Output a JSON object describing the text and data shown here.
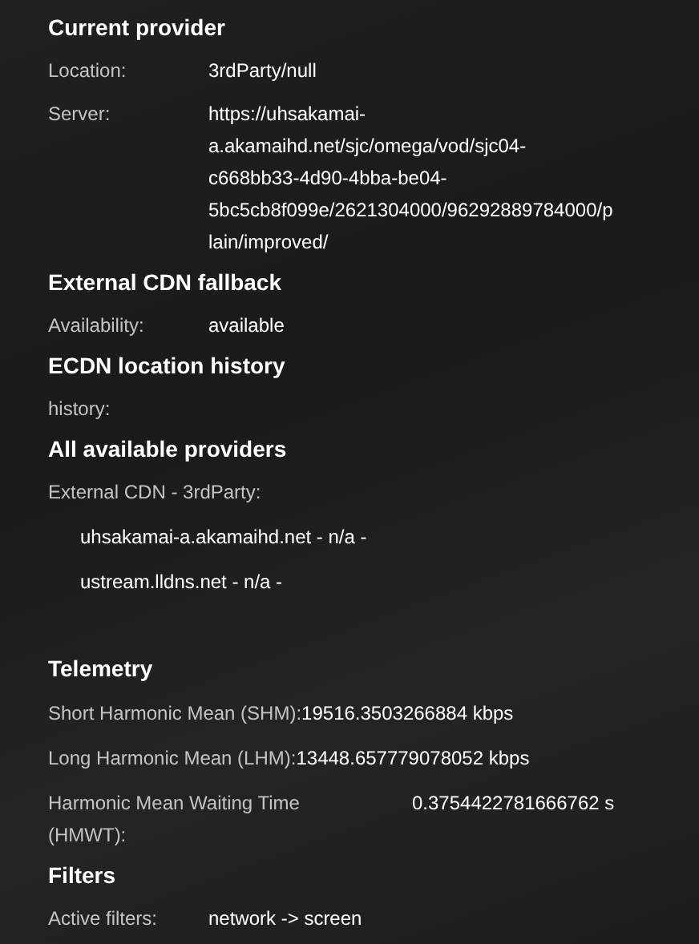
{
  "sections": [
    {
      "title": "Current provider",
      "rows": [
        {
          "kind": "pair",
          "label": "Location:",
          "value": "3rdParty/null"
        },
        {
          "kind": "pair",
          "label": "Server:",
          "value": "https://uhsakamai-a.akamaihd.net/sjc/omega/vod/sjc04-c668bb33-4d90-4bba-be04-5bc5cb8f099e/2621304000/96292889784000/plain/improved/"
        }
      ]
    },
    {
      "title": "External CDN fallback",
      "rows": [
        {
          "kind": "pair",
          "label": "Availability:",
          "value": "available"
        }
      ]
    },
    {
      "title": "ECDN location history",
      "rows": [
        {
          "kind": "note",
          "label": "history:"
        }
      ]
    },
    {
      "title": "All available providers",
      "rows": [
        {
          "kind": "note",
          "label": "External CDN - 3rdParty:"
        },
        {
          "kind": "item",
          "value": "uhsakamai-a.akamaihd.net - n/a -"
        },
        {
          "kind": "item",
          "value": "ustream.lldns.net - n/a -"
        }
      ]
    },
    {
      "title": "Telemetry",
      "rows": [
        {
          "kind": "inline",
          "label": "Short Harmonic Mean (SHM):",
          "value": "19516.3503266884 kbps"
        },
        {
          "kind": "inline",
          "label": "Long Harmonic Mean (LHM):",
          "value": "13448.657779078052 kbps"
        },
        {
          "kind": "wide",
          "label": "Harmonic Mean Waiting Time (HMWT):",
          "value": "0.3754422781666762 s"
        }
      ]
    },
    {
      "title": "Filters",
      "rows": [
        {
          "kind": "pair",
          "label": "Active filters:",
          "value": "network -> screen"
        }
      ]
    }
  ]
}
